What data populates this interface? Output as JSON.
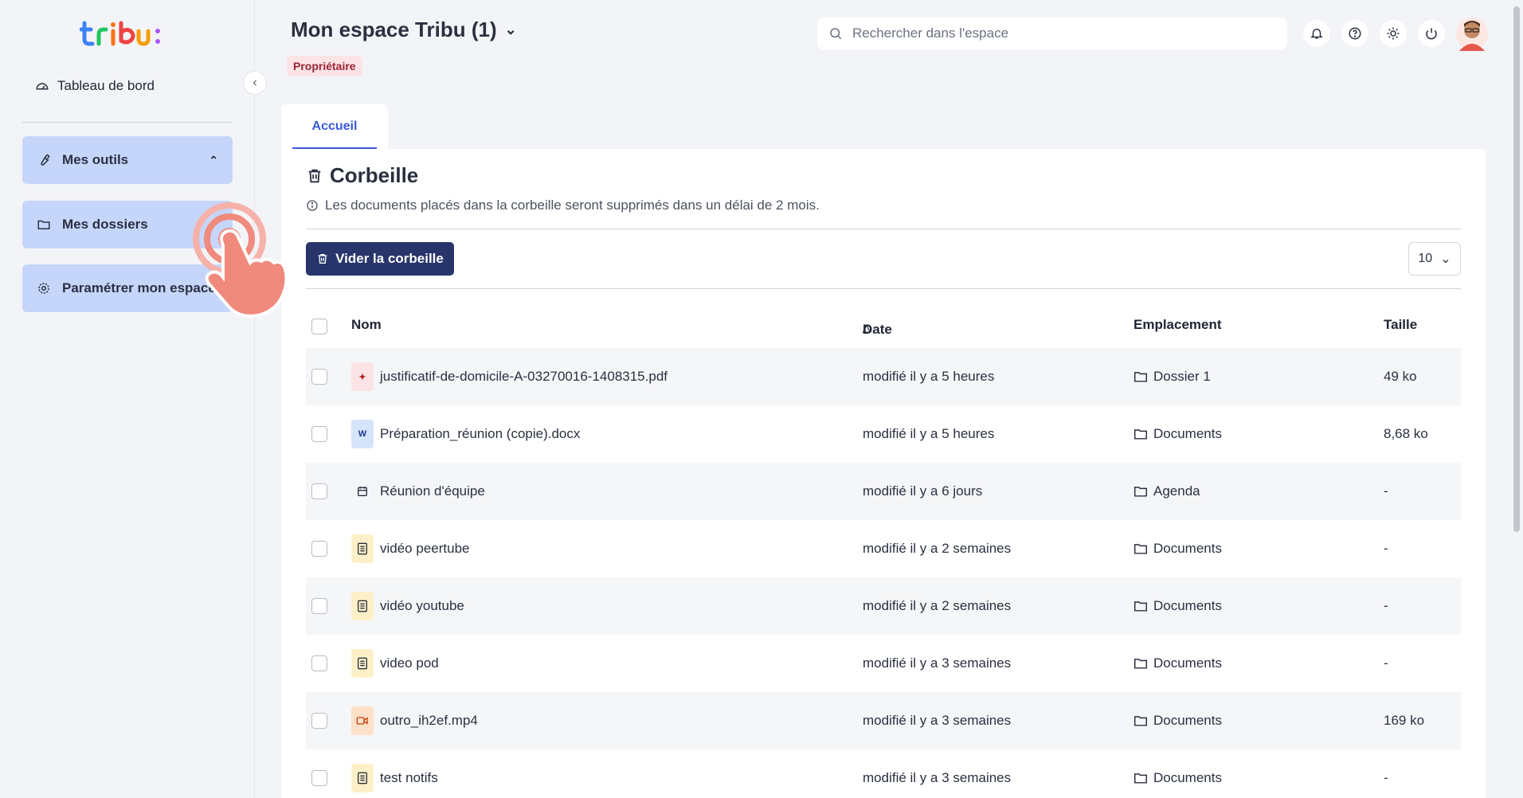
{
  "sidebar": {
    "logo_text": "tribu:",
    "dashboard_label": "Tableau de bord",
    "items": [
      {
        "label": "Mes outils",
        "icon": "wrench-icon",
        "state": "expanded"
      },
      {
        "label": "Mes dossiers",
        "icon": "folder-icon",
        "state": "expanded"
      },
      {
        "label": "Paramétrer mon espace",
        "icon": "gear-icon"
      }
    ]
  },
  "header": {
    "space_title": "Mon espace Tribu (1)",
    "role_badge": "Propriétaire",
    "search_placeholder": "Rechercher dans l'espace"
  },
  "tabs": [
    {
      "label": "Accueil",
      "active": true
    }
  ],
  "trash": {
    "title": "Corbeille",
    "info": "Les documents placés dans la corbeille seront supprimés dans un délai de 2 mois.",
    "empty_button": "Vider la corbeille",
    "page_size": "10"
  },
  "table": {
    "columns": {
      "name": "Nom",
      "date": "Date",
      "location": "Emplacement",
      "size": "Taille"
    },
    "sort": {
      "column": "Date",
      "direction": "ascending"
    },
    "rows": [
      {
        "name": "justificatif-de-domicile-A-03270016-1408315.pdf",
        "date": "modifié il y a 5 heures",
        "location": "Dossier 1",
        "size": "49 ko",
        "type": "pdf"
      },
      {
        "name": "Préparation_réunion (copie).docx",
        "date": "modifié il y a 5 heures",
        "location": "Documents",
        "size": "8,68 ko",
        "type": "word"
      },
      {
        "name": "Réunion d'équipe",
        "date": "modifié il y a 6 jours",
        "location": "Agenda",
        "size": "-",
        "type": "event"
      },
      {
        "name": "vidéo peertube",
        "date": "modifié il y a 2 semaines",
        "location": "Documents",
        "size": "-",
        "type": "note"
      },
      {
        "name": "vidéo youtube",
        "date": "modifié il y a 2 semaines",
        "location": "Documents",
        "size": "-",
        "type": "note"
      },
      {
        "name": "video pod",
        "date": "modifié il y a 3 semaines",
        "location": "Documents",
        "size": "-",
        "type": "note"
      },
      {
        "name": "outro_ih2ef.mp4",
        "date": "modifié il y a 3 semaines",
        "location": "Documents",
        "size": "169 ko",
        "type": "video"
      },
      {
        "name": "test notifs",
        "date": "modifié il y a 3 semaines",
        "location": "Documents",
        "size": "-",
        "type": "note"
      }
    ]
  },
  "colors": {
    "accent": "#3a5bd8",
    "primary_button": "#27356a",
    "sidebar_button": "#c6d6fb",
    "role_badge_bg": "#fbe3e6",
    "role_badge_text": "#9b2335"
  }
}
